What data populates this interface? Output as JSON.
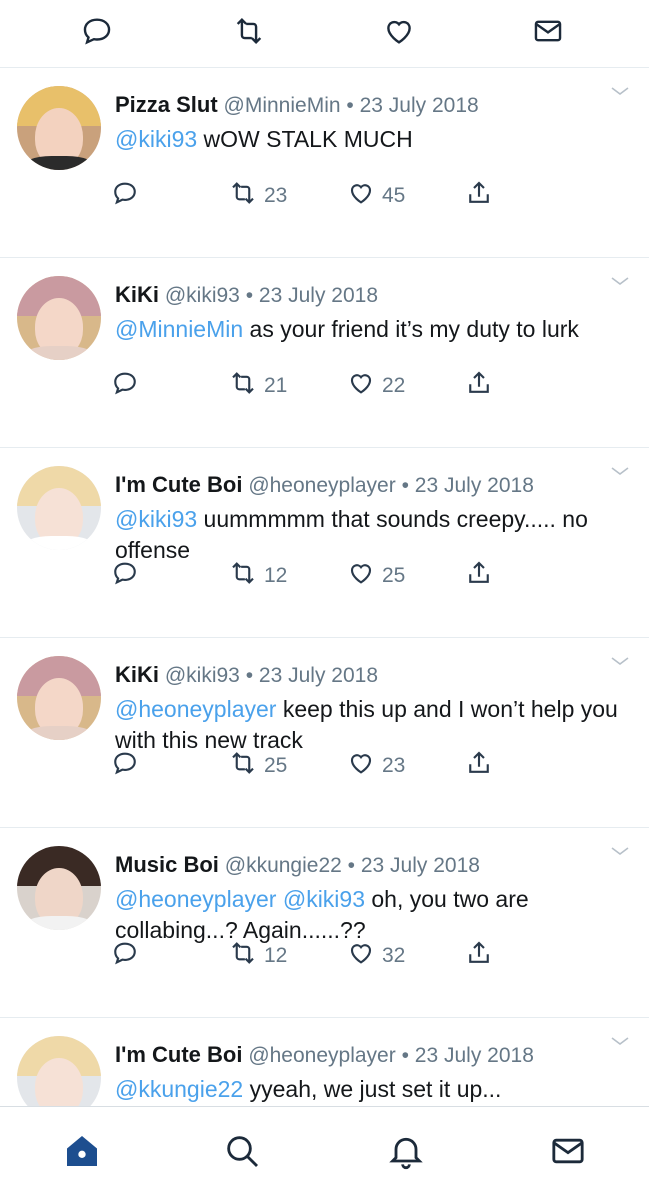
{
  "tweets": [
    {
      "name": "Pizza Slut",
      "handle": "@MinnieMin",
      "dot": "•",
      "date": "23 July 2018",
      "text_parts": [
        {
          "m": true,
          "t": "@kiki93"
        },
        {
          "m": false,
          "t": " wOW STALK MUCH"
        }
      ],
      "retweets": "23",
      "likes": "45",
      "avatar": {
        "hair": "#e8c06a",
        "bg": "#c9a17c",
        "face": "#f3d2bf",
        "shirt": "#2b2b2b"
      }
    },
    {
      "name": "KiKi",
      "handle": "@kiki93",
      "dot": "•",
      "date": "23 July 2018",
      "text_parts": [
        {
          "m": true,
          "t": "@MinnieMin"
        },
        {
          "m": false,
          "t": " as your friend it’s my duty to lurk"
        }
      ],
      "retweets": "21",
      "likes": "22",
      "avatar": {
        "hair": "#c99aa0",
        "bg": "#d8b88a",
        "face": "#f4d7c8",
        "shirt": "#e6d0c6"
      }
    },
    {
      "name": "I'm Cute Boi",
      "handle": "@heoneyplayer",
      "dot": "•",
      "date": "23 July 2018",
      "text_parts": [
        {
          "m": true,
          "t": "@kiki93"
        },
        {
          "m": false,
          "t": " uummmmm that sounds creepy..... no offense"
        }
      ],
      "retweets": "12",
      "likes": "25",
      "avatar": {
        "hair": "#efd9a8",
        "bg": "#e3e6ea",
        "face": "#f6e1d6",
        "shirt": "#ffffff"
      }
    },
    {
      "name": "KiKi",
      "handle": "@kiki93",
      "dot": "•",
      "date": "23 July 2018",
      "text_parts": [
        {
          "m": true,
          "t": "@heoneyplayer"
        },
        {
          "m": false,
          "t": " keep this up and I won’t help you with this new track"
        }
      ],
      "retweets": "25",
      "likes": "23",
      "avatar": {
        "hair": "#c99aa0",
        "bg": "#d8b88a",
        "face": "#f4d7c8",
        "shirt": "#e6d0c6"
      }
    },
    {
      "name": "Music Boi",
      "handle": "@kkungie22",
      "dot": "•",
      "date": "23 July 2018",
      "text_parts": [
        {
          "m": true,
          "t": "@heoneyplayer @kiki93"
        },
        {
          "m": false,
          "t": " oh, you two are collabing...? Again......??"
        }
      ],
      "retweets": "12",
      "likes": "32",
      "avatar": {
        "hair": "#3a2a24",
        "bg": "#d9d2cc",
        "face": "#efd6c8",
        "shirt": "#f2f2f2"
      }
    },
    {
      "name": "I'm Cute Boi",
      "handle": "@heoneyplayer",
      "dot": "•",
      "date": "23 July 2018",
      "text_parts": [
        {
          "m": true,
          "t": "@kkungie22"
        },
        {
          "m": false,
          "t": " yyeah, we just set it up..."
        }
      ],
      "retweets": "",
      "likes": "",
      "avatar": {
        "hair": "#efd9a8",
        "bg": "#e3e6ea",
        "face": "#f6e1d6",
        "shirt": "#ffffff"
      }
    }
  ],
  "top_actions": [
    "reply-icon",
    "retweet-icon",
    "like-icon",
    "message-icon"
  ],
  "tabs": [
    "home-icon",
    "search-icon",
    "notifications-icon",
    "messages-icon"
  ],
  "colors": {
    "accent": "#1da1f2",
    "mention": "#4aa1eb",
    "muted": "#657786",
    "home_active": "#1d4e8f"
  }
}
